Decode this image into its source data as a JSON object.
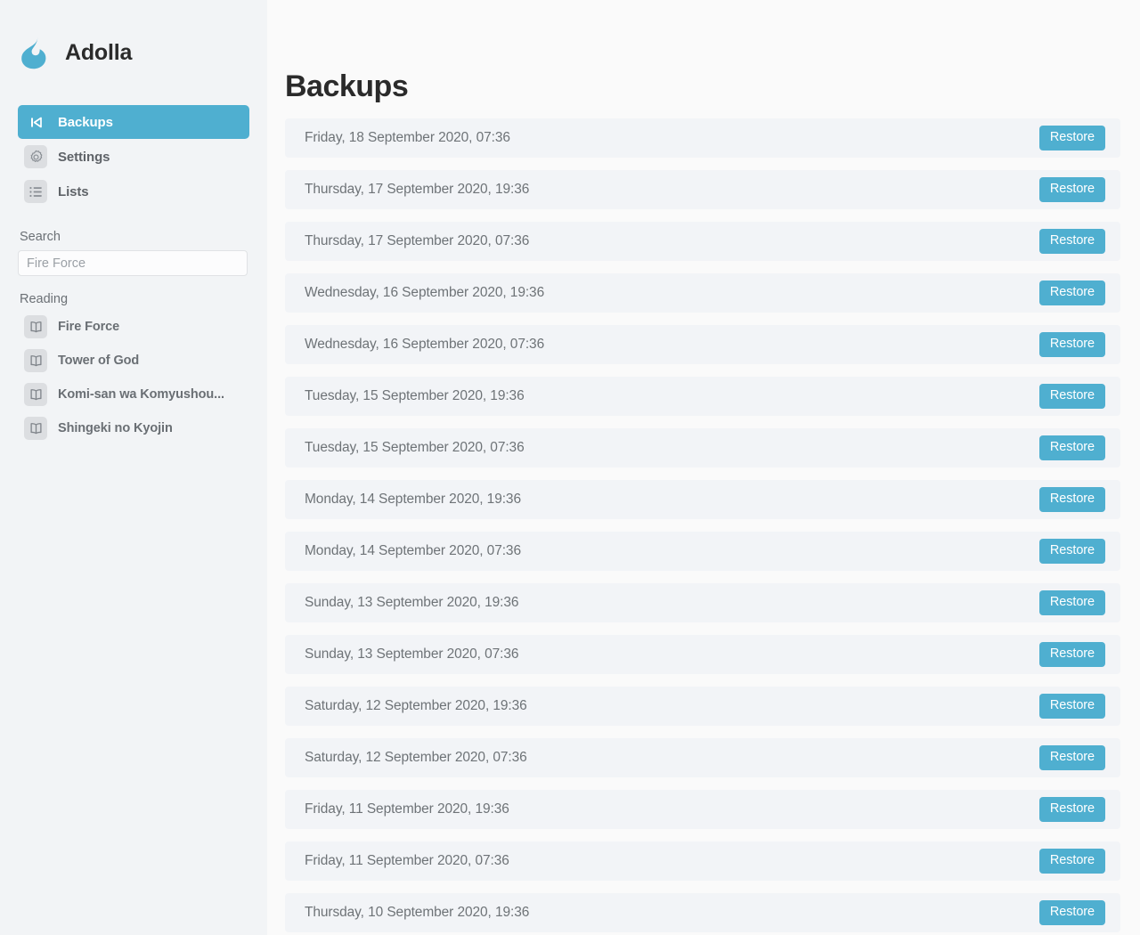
{
  "brand": {
    "name": "Adolla",
    "logo_icon": "flame-icon",
    "accent_color": "#4fafd0"
  },
  "sidebar": {
    "nav": [
      {
        "label": "Backups",
        "icon": "skip-back-icon",
        "active": true
      },
      {
        "label": "Settings",
        "icon": "gear-icon",
        "active": false
      },
      {
        "label": "Lists",
        "icon": "list-icon",
        "active": false
      }
    ],
    "search": {
      "label": "Search",
      "placeholder": "Fire Force",
      "value": ""
    },
    "reading": {
      "label": "Reading",
      "items": [
        {
          "label": "Fire Force",
          "icon": "book-icon"
        },
        {
          "label": "Tower of God",
          "icon": "book-icon"
        },
        {
          "label": "Komi-san wa Komyushou...",
          "icon": "book-icon"
        },
        {
          "label": "Shingeki no Kyojin",
          "icon": "book-icon"
        }
      ]
    }
  },
  "main": {
    "title": "Backups",
    "restore_label": "Restore",
    "backups": [
      {
        "date": "Friday, 18 September 2020, 07:36"
      },
      {
        "date": "Thursday, 17 September 2020, 19:36"
      },
      {
        "date": "Thursday, 17 September 2020, 07:36"
      },
      {
        "date": "Wednesday, 16 September 2020, 19:36"
      },
      {
        "date": "Wednesday, 16 September 2020, 07:36"
      },
      {
        "date": "Tuesday, 15 September 2020, 19:36"
      },
      {
        "date": "Tuesday, 15 September 2020, 07:36"
      },
      {
        "date": "Monday, 14 September 2020, 19:36"
      },
      {
        "date": "Monday, 14 September 2020, 07:36"
      },
      {
        "date": "Sunday, 13 September 2020, 19:36"
      },
      {
        "date": "Sunday, 13 September 2020, 07:36"
      },
      {
        "date": "Saturday, 12 September 2020, 19:36"
      },
      {
        "date": "Saturday, 12 September 2020, 07:36"
      },
      {
        "date": "Friday, 11 September 2020, 19:36"
      },
      {
        "date": "Friday, 11 September 2020, 07:36"
      },
      {
        "date": "Thursday, 10 September 2020, 19:36"
      }
    ]
  }
}
